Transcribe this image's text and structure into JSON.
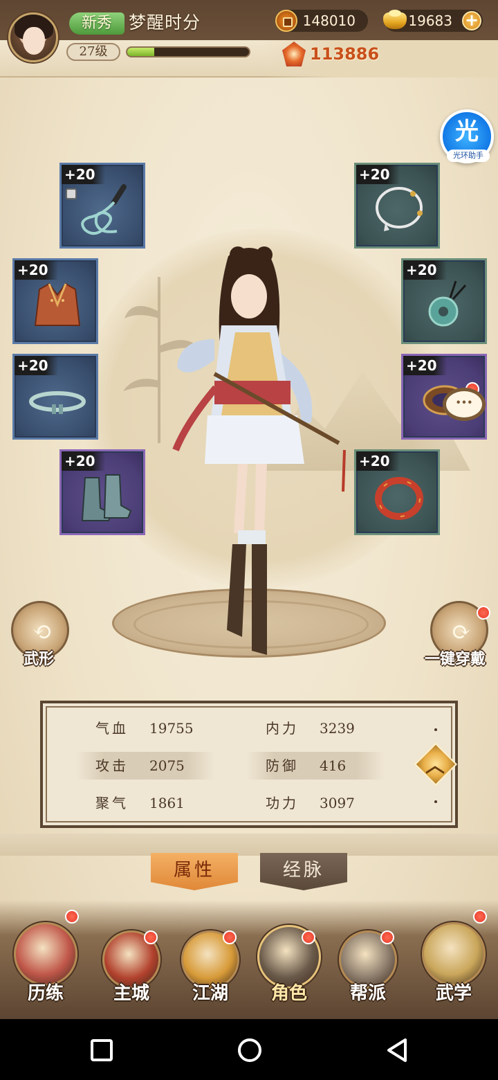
{
  "player": {
    "badge": "新秀",
    "name": "梦醒时分",
    "level": "27级",
    "exp_fraction": 0.22,
    "power": "113886"
  },
  "currency": {
    "coins": "148010",
    "gold": "19683"
  },
  "assistant": {
    "glyph": "光",
    "label": "光环助手"
  },
  "equipment": {
    "plus_label": "+20",
    "slots": [
      {
        "name": "whip",
        "icon": "whip-icon"
      },
      {
        "name": "necklace",
        "icon": "necklace-icon"
      },
      {
        "name": "armor",
        "icon": "armor-vest-icon"
      },
      {
        "name": "jade-pendant",
        "icon": "jade-pendant-icon"
      },
      {
        "name": "belt",
        "icon": "belt-icon"
      },
      {
        "name": "wrist-guard",
        "icon": "wrist-guard-icon"
      },
      {
        "name": "boots",
        "icon": "boots-icon"
      },
      {
        "name": "bracelet",
        "icon": "bracelet-icon"
      }
    ]
  },
  "actions": {
    "left": "武形",
    "right": "一键穿戴"
  },
  "stats": {
    "rows": [
      [
        {
          "label": "气血",
          "value": "19755"
        },
        {
          "label": "内力",
          "value": "3239"
        }
      ],
      [
        {
          "label": "攻击",
          "value": "2075"
        },
        {
          "label": "防御",
          "value": "416"
        }
      ],
      [
        {
          "label": "聚气",
          "value": "1861"
        },
        {
          "label": "功力",
          "value": "3097"
        }
      ]
    ]
  },
  "tabs": {
    "active": "属性",
    "inactive": "经脉"
  },
  "nav": {
    "items": [
      {
        "label": "历练",
        "color": "#c0574a",
        "dot": true
      },
      {
        "label": "主城",
        "color": "#b2422e",
        "dot": true
      },
      {
        "label": "江湖",
        "color": "#d79a38",
        "dot": true
      },
      {
        "label": "角色",
        "color": "#6a5a4a",
        "dot": true
      },
      {
        "label": "帮派",
        "color": "#8a7a6a",
        "dot": true
      },
      {
        "label": "武学",
        "color": "#c9a65a",
        "dot": true
      }
    ]
  },
  "colors": {
    "accent_orange": "#e08838",
    "power_red": "#c8501c",
    "notify_red": "#e53b2a"
  }
}
